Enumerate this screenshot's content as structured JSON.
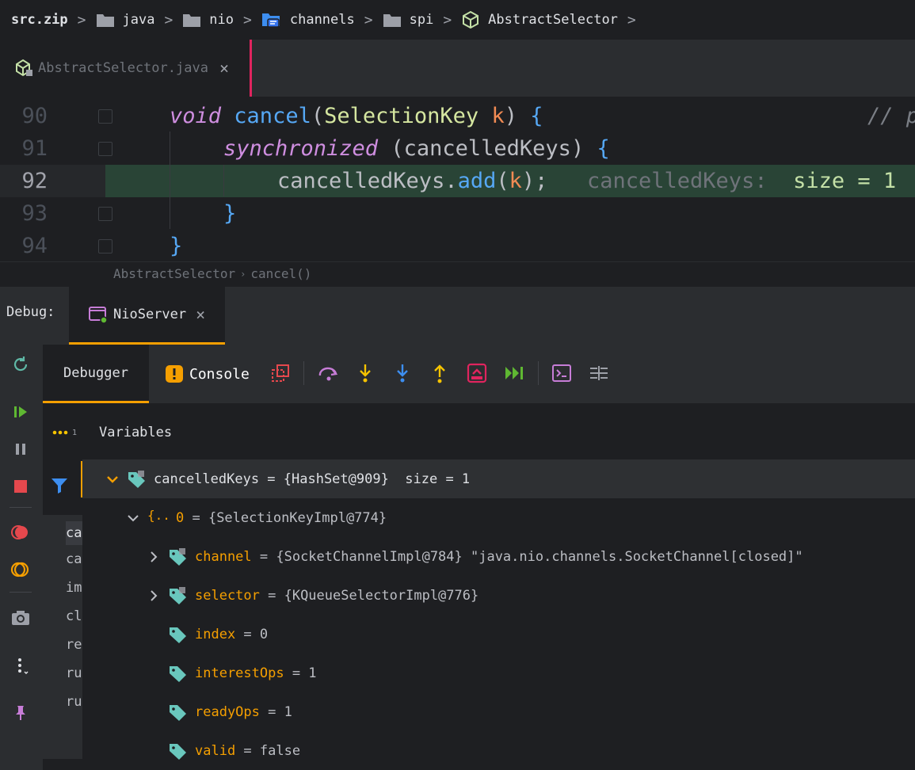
{
  "breadcrumb": {
    "items": [
      {
        "label": "src.zip"
      },
      {
        "label": "java"
      },
      {
        "label": "nio"
      },
      {
        "label": "channels"
      },
      {
        "label": "spi"
      },
      {
        "label": "AbstractSelector"
      }
    ],
    "separator": ">"
  },
  "editor_tab": {
    "label": "AbstractSelector.java",
    "close": "×"
  },
  "editor": {
    "lines": [
      {
        "number": "90"
      },
      {
        "number": "91"
      },
      {
        "number": "92"
      },
      {
        "number": "93"
      },
      {
        "number": "94"
      }
    ],
    "code": {
      "l90_kw": "void",
      "l90_fn": "cancel",
      "l90_open": "(",
      "l90_type": "SelectionKey",
      "l90_param": "k",
      "l90_close": ")",
      "l90_brace": "{",
      "l90_comment": "// p",
      "l91_kw": "synchronized",
      "l91_open": "(",
      "l91_var": "cancelledKeys",
      "l91_close": ")",
      "l91_brace": "{",
      "l92_var": "cancelledKeys",
      "l92_dot": ".",
      "l92_fn": "add",
      "l92_open": "(",
      "l92_param": "k",
      "l92_close": ");",
      "l92_inline_label": "cancelledKeys:",
      "l92_inline_value": "size = 1",
      "l93_brace": "}",
      "l94_brace": "}"
    },
    "structure_crumb": {
      "class": "AbstractSelector",
      "method": "cancel()",
      "sep": "›"
    }
  },
  "debug": {
    "label": "Debug:",
    "session_tab": "NioServer",
    "session_close": "×",
    "tabs": {
      "debugger": "Debugger",
      "console": "Console"
    },
    "variables_title": "Variables",
    "dots_sub": "1",
    "frames": [
      "ca",
      "ca",
      "im",
      "cl",
      "re",
      "ru",
      "ru"
    ],
    "variables": [
      {
        "name": "cancelledKeys",
        "value": " = {HashSet@909}  size = 1"
      },
      {
        "name": "0",
        "value": " = {SelectionKeyImpl@774}"
      },
      {
        "name": "channel",
        "value": " = {SocketChannelImpl@784} \"java.nio.channels.SocketChannel[closed]\""
      },
      {
        "name": "selector",
        "value": " = {KQueueSelectorImpl@776}"
      },
      {
        "name": "index",
        "value": " = 0"
      },
      {
        "name": "interestOps",
        "value": " = 1"
      },
      {
        "name": "readyOps",
        "value": " = 1"
      },
      {
        "name": "valid",
        "value": " = false"
      }
    ]
  },
  "colors": {
    "accent": "#f59f00",
    "execution_line": "#294436",
    "tab_marker": "#e0245e"
  }
}
